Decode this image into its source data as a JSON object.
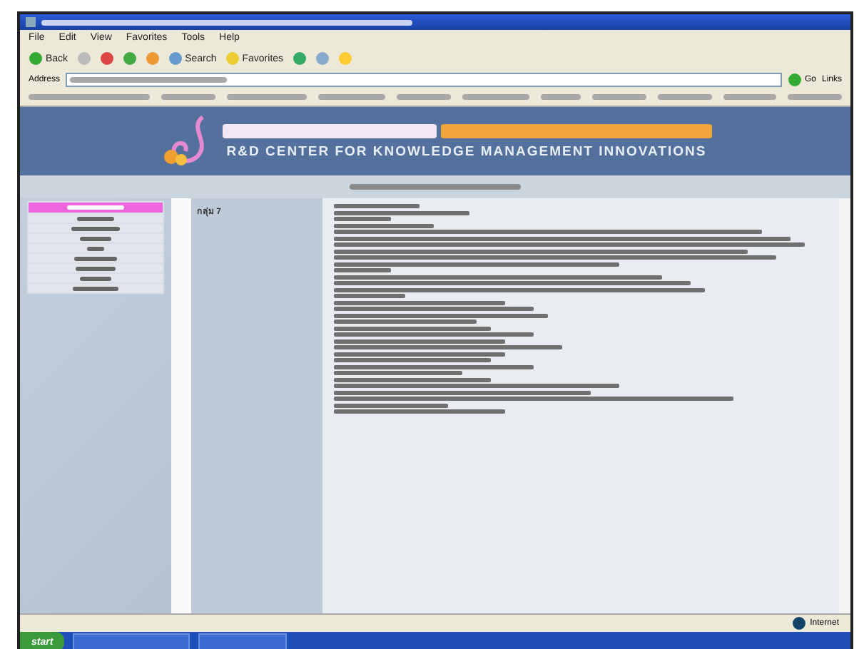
{
  "menu_bar": {
    "items": [
      "File",
      "Edit",
      "View",
      "Favorites",
      "Tools",
      "Help"
    ]
  },
  "toolbar": {
    "back": "Back",
    "search": "Search",
    "favorites": "Favorites"
  },
  "address_bar": {
    "label": "Address",
    "go": "Go",
    "links": "Links"
  },
  "banner": {
    "subtitle": "R&D CENTER FOR KNOWLEDGE MANAGEMENT INNOVATIONS"
  },
  "content": {
    "group_label": "กลุ่ม 7"
  },
  "status_bar": {
    "zone": "Internet"
  },
  "taskbar": {
    "start": "start"
  }
}
